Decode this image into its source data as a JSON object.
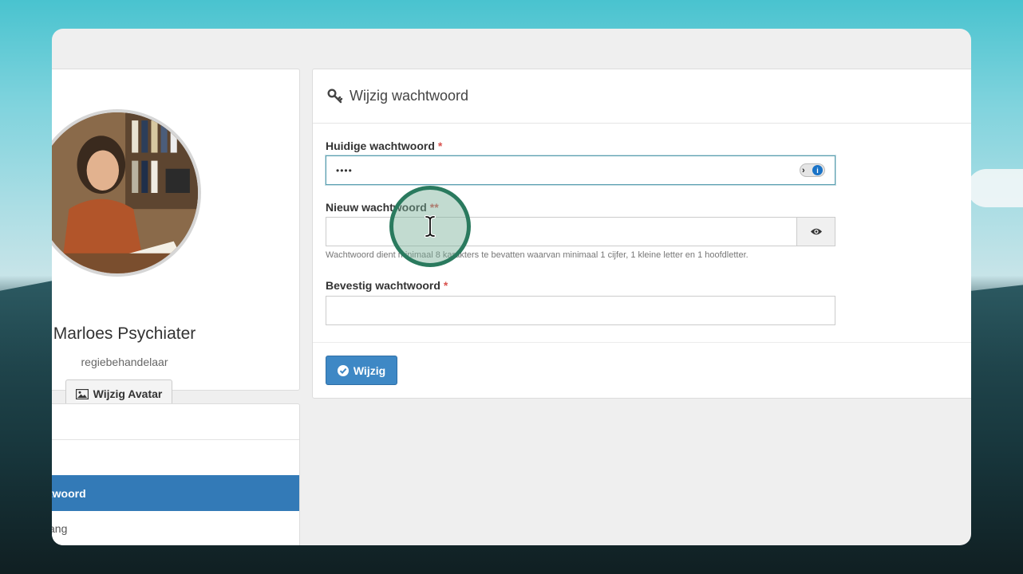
{
  "profile": {
    "name": "Marloes Psychiater",
    "role": "regiebehandelaar",
    "avatar_button": "Wijzig Avatar"
  },
  "menu": {
    "active_item": "twoord",
    "next_item": "ang"
  },
  "panel": {
    "title": "Wijzig wachtwoord",
    "current_password": {
      "label": "Huidige wachtwoord",
      "required_mark": "*",
      "value": "••••"
    },
    "new_password": {
      "label": "Nieuw wachtwoord",
      "required_mark": "**",
      "help": "Wachtwoord dient minimaal 8 karakters te bevatten waarvan minimaal 1 cijfer, 1 kleine letter en 1 hoofdletter."
    },
    "confirm_password": {
      "label": "Bevestig wachtwoord",
      "required_mark": "*"
    },
    "submit_label": "Wijzig"
  },
  "colors": {
    "primary": "#337ab7",
    "required": "#d9534f",
    "cursor_ring": "#2a7a5e"
  }
}
